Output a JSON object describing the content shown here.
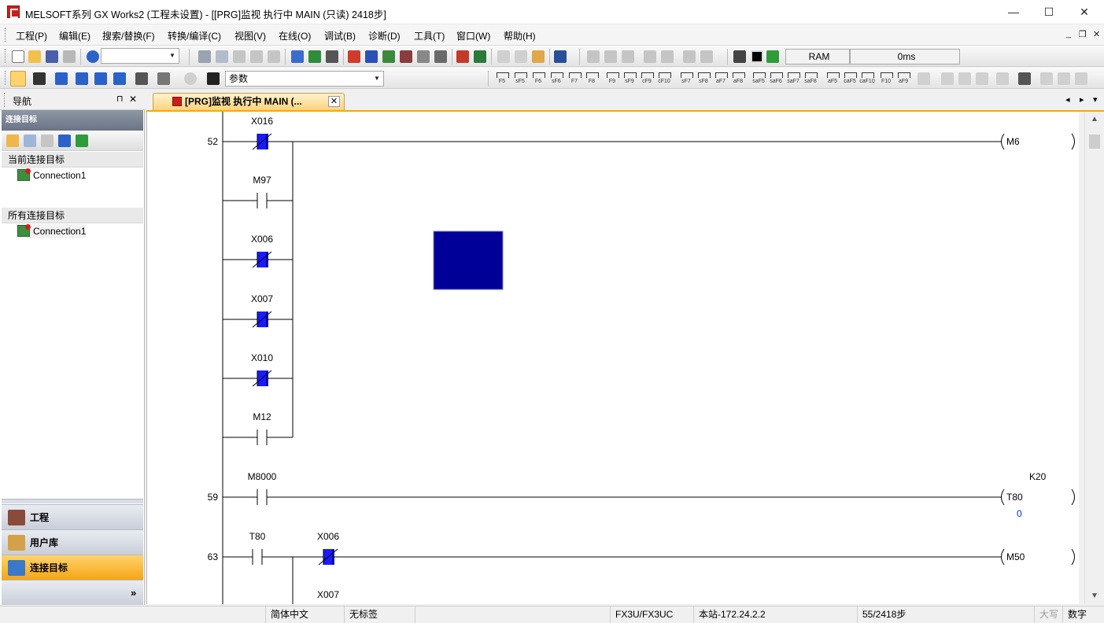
{
  "window": {
    "title": "MELSOFT系列 GX Works2 (工程未设置) - [[PRG]监视 执行中 MAIN (只读) 2418步]",
    "minimize": "—",
    "maximize": "☐",
    "close": "✕",
    "mdi_minimize": "_",
    "mdi_restore": "❐",
    "mdi_close": "✕"
  },
  "menu": {
    "items": [
      "工程(P)",
      "编辑(E)",
      "搜索/替换(F)",
      "转换/编译(C)",
      "视图(V)",
      "在线(O)",
      "调试(B)",
      "诊断(D)",
      "工具(T)",
      "窗口(W)",
      "帮助(H)"
    ]
  },
  "toolbar": {
    "combo1_value": "",
    "combo2_value": "参数",
    "memory_label": "RAM",
    "scan_time": "0ms",
    "fkeys": [
      "F5",
      "sF5",
      "F6",
      "sF6",
      "F7",
      "F8",
      "F9",
      "sF9",
      "cF9",
      "cF10",
      "sF7",
      "sF8",
      "aF7",
      "aF8",
      "saF5",
      "saF6",
      "saF7",
      "saF8",
      "aF5",
      "caF5",
      "caF10",
      "F10",
      "aF9"
    ]
  },
  "nav": {
    "title": "导航",
    "pin": "⊓",
    "close": "✕",
    "subheader": "连接目标",
    "current_section": "当前连接目标",
    "current_connection": "Connection1",
    "all_section": "所有连接目标",
    "all_connection": "Connection1",
    "buttons": [
      "工程",
      "用户库",
      "连接目标"
    ],
    "more": "»"
  },
  "tab": {
    "label": "[PRG]监视 执行中 MAIN (...",
    "close": "✕",
    "nav_left": "◂",
    "nav_right": "▸",
    "nav_menu": "▾"
  },
  "ladder": {
    "rungs": [
      {
        "step": "52",
        "coil": "M6"
      },
      {
        "step": "59",
        "coil": "T80",
        "constant": "K20",
        "current_value": "0"
      },
      {
        "step": "63",
        "coil": "M50"
      }
    ],
    "contacts": [
      {
        "device": "X016",
        "type": "NC",
        "active": true
      },
      {
        "device": "M97",
        "type": "NO",
        "active": false
      },
      {
        "device": "X006",
        "type": "NC",
        "active": true
      },
      {
        "device": "X007",
        "type": "NC",
        "active": true
      },
      {
        "device": "X010",
        "type": "NC",
        "active": true
      },
      {
        "device": "M12",
        "type": "NO",
        "active": false
      },
      {
        "device": "M8000",
        "type": "NO",
        "active": false
      },
      {
        "device": "T80",
        "type": "NO",
        "active": false
      },
      {
        "device": "X006",
        "type": "NC",
        "active": true
      },
      {
        "device": "X007",
        "type": "NC",
        "active": false
      }
    ],
    "cursor_color": "#000099",
    "active_color": "#1a1aff"
  },
  "statusbar": {
    "language": "简体中文",
    "label": "无标签",
    "plc_type": "FX3U/FX3UC",
    "station": "本站-172.24.2.2",
    "steps": "55/2418步",
    "caps": "大写",
    "num": "数字"
  }
}
